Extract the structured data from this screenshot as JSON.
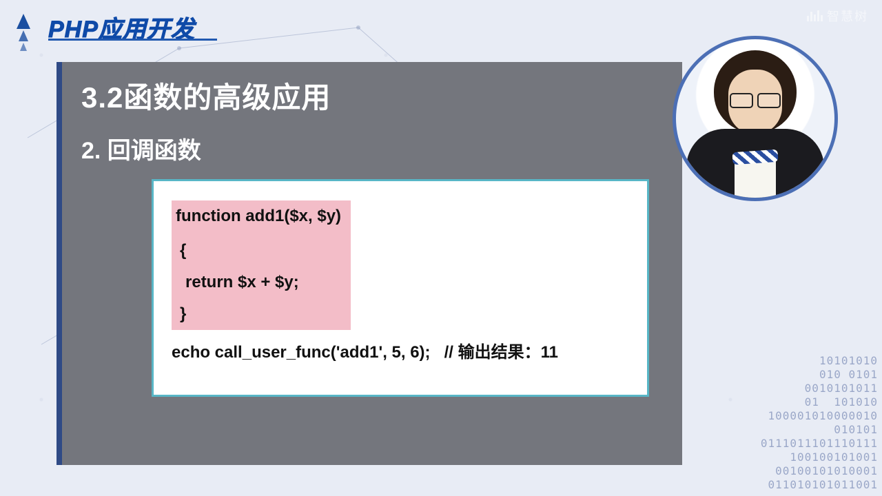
{
  "header": {
    "title": "PHP应用开发"
  },
  "slide": {
    "heading": "3.2函数的高级应用",
    "subheading": "2. 回调函数"
  },
  "code": {
    "line1": "function add1($x, $y)",
    "line2": "{",
    "line3": "return $x + $y;",
    "line4": "}",
    "call": "echo call_user_func('add1', 5, 6);",
    "comment": "// 输出结果：11"
  },
  "watermark": "智慧树",
  "binary": "10101010\n010 0101\n0010101011\n01  101010\n100001010000010\n010101\n0111011101110111\n100100101001\n00100101010001\n011010101011001"
}
